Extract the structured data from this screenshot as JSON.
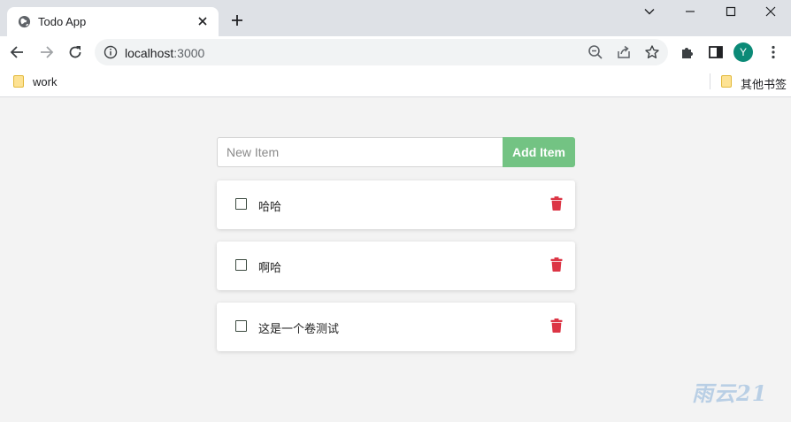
{
  "browser": {
    "tab_title": "Todo App",
    "url_host": "localhost",
    "url_port": ":3000",
    "avatar_letter": "Y",
    "bookmarks": [
      {
        "label": "work"
      },
      {
        "label": "其他书签"
      }
    ]
  },
  "app": {
    "input_placeholder": "New Item",
    "input_value": "",
    "add_button_label": "Add Item",
    "items": [
      {
        "text": "哈哈",
        "checked": false
      },
      {
        "text": "啊哈",
        "checked": false
      },
      {
        "text": "这是一个卷测试",
        "checked": false
      }
    ]
  },
  "colors": {
    "add_button": "#73c383",
    "delete_icon": "#dc3545",
    "background": "#f3f3f3",
    "avatar": "#0b8a77"
  },
  "icons": {
    "tab_favicon": "globe-icon",
    "delete": "trash-icon"
  },
  "watermark": "雨云21"
}
